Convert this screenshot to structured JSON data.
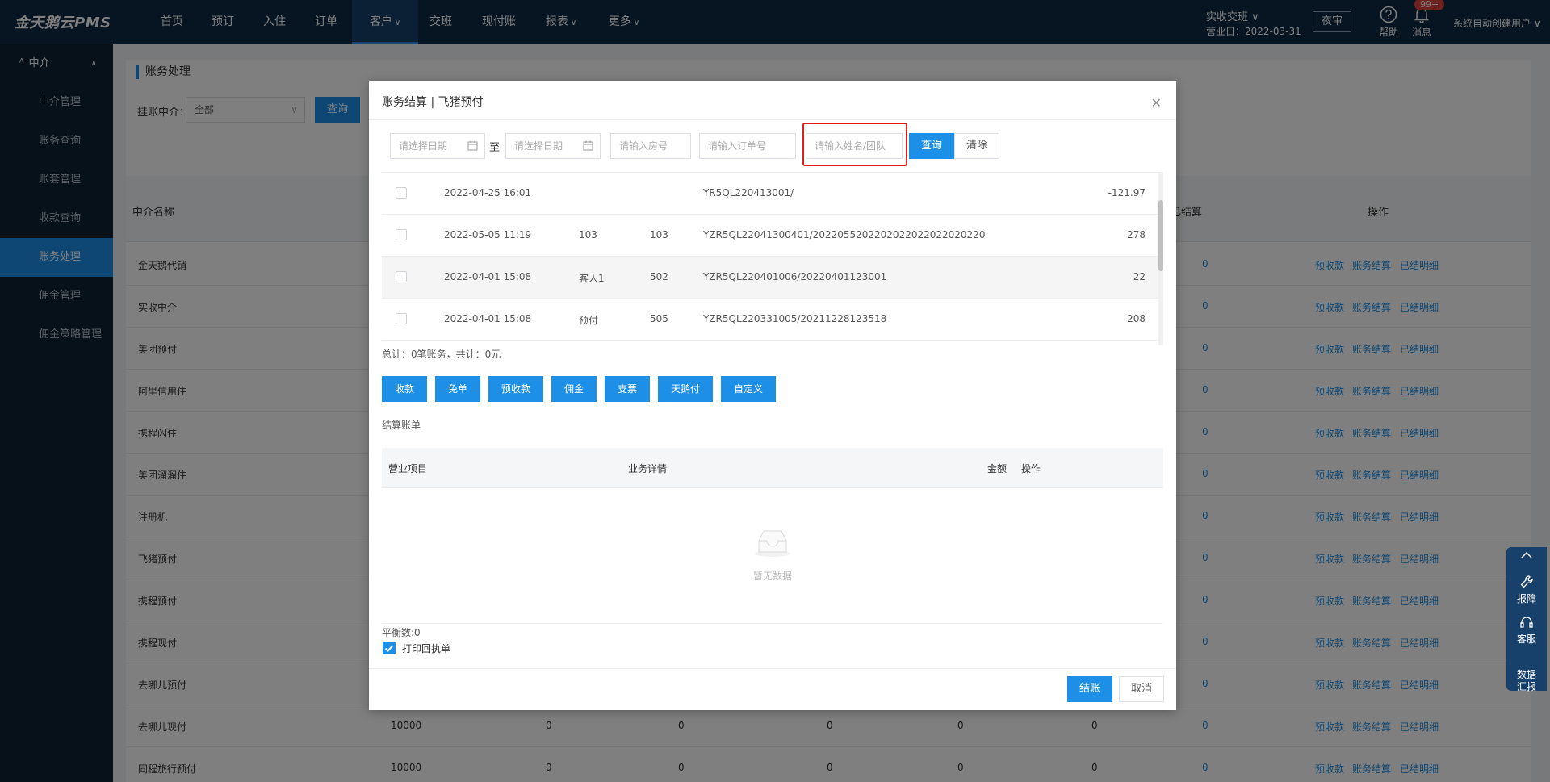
{
  "app": {
    "logo": "金天鹅云PMS"
  },
  "nav": [
    {
      "label": "首页"
    },
    {
      "label": "预订"
    },
    {
      "label": "入住"
    },
    {
      "label": "订单"
    },
    {
      "label": "客户",
      "dropdown": true,
      "active": true
    },
    {
      "label": "交班"
    },
    {
      "label": "现付账"
    },
    {
      "label": "报表",
      "dropdown": true
    },
    {
      "label": "更多",
      "dropdown": true
    }
  ],
  "topbar": {
    "shift_label": "实收交班 ∨",
    "business_day": "营业日：2022-03-31",
    "night_button": "夜审",
    "help_label": "帮助",
    "message_label": "消息",
    "message_badge": "99+",
    "user": "系统自动创建用户 ∨"
  },
  "sidebar": {
    "section": "中介",
    "items": [
      "中介管理",
      "账务查询",
      "账套管理",
      "收款查询",
      "账务处理",
      "佣金管理",
      "佣金策略管理"
    ],
    "active_index": 4
  },
  "page": {
    "title": "账务处理",
    "filter_label": "挂账中介：",
    "filter_value": "全部",
    "query_button": "查询"
  },
  "table": {
    "headers": {
      "name": "中介名称",
      "settled": "已结算",
      "actions": "操作"
    },
    "row_actions": [
      "预收款",
      "账务结算",
      "已结明细"
    ],
    "rows": [
      {
        "name": "金天鹅代销",
        "settled": "0"
      },
      {
        "name": "实收中介",
        "settled": "0"
      },
      {
        "name": "美团预付",
        "settled": "0"
      },
      {
        "name": "阿里信用住",
        "settled": "0"
      },
      {
        "name": "携程闪住",
        "settled": "0"
      },
      {
        "name": "美团溜溜住",
        "settled": "0"
      },
      {
        "name": "注册机",
        "settled": "0"
      },
      {
        "name": "飞猪预付",
        "settled": "0"
      },
      {
        "name": "携程预付",
        "settled": "0"
      },
      {
        "name": "携程现付",
        "settled": "0"
      },
      {
        "name": "去哪儿预付",
        "settled": "0"
      },
      {
        "name": "去哪儿现付",
        "credit": "10000",
        "c1": "0",
        "c2": "0",
        "c3": "0",
        "c4": "0",
        "c5": "0",
        "settled": "0"
      },
      {
        "name": "同程旅行预付",
        "credit": "10000",
        "c1": "0",
        "c2": "0",
        "c3": "0",
        "c4": "0",
        "c5": "0",
        "settled": "0"
      }
    ]
  },
  "modal": {
    "title": "账务结算 | 飞猪预付",
    "date_from_placeholder": "请选择日期",
    "to_label": "至",
    "date_to_placeholder": "请选择日期",
    "room_placeholder": "请输入房号",
    "order_placeholder": "请输入订单号",
    "name_placeholder": "请输入姓名/团队",
    "query_button": "查询",
    "clear_button": "清除",
    "records": [
      {
        "time": "2022-04-25 16:01",
        "guest": "",
        "room": "",
        "order": "YR5QL220413001/",
        "amount": "-121.97"
      },
      {
        "time": "2022-05-05 11:19",
        "guest": "103",
        "room": "103",
        "order": "YZR5QL22041300401/2022055202202022022022020220",
        "amount": "278"
      },
      {
        "time": "2022-04-01 15:08",
        "guest": "客人1",
        "room": "502",
        "order": "YZR5QL220401006/20220401123001",
        "amount": "22"
      },
      {
        "time": "2022-04-01 15:08",
        "guest": "预付",
        "room": "505",
        "order": "YZR5QL220331005/20211228123518",
        "amount": "208"
      }
    ],
    "summary": "总计：0笔账务，共计：0元",
    "actions": [
      "收款",
      "免单",
      "预收款",
      "佣金",
      "支票",
      "天鹅付",
      "自定义"
    ],
    "settle_title": "结算账单",
    "settle_headers": {
      "item": "营业项目",
      "detail": "业务详情",
      "amount": "金额",
      "op": "操作"
    },
    "empty_text": "暂无数据",
    "balance": "平衡数:0",
    "print_label": "打印回执单",
    "print_checked": true,
    "confirm_button": "结账",
    "cancel_button": "取消"
  },
  "float_panel": {
    "items": [
      "报障",
      "客服",
      "数据\n汇报"
    ]
  }
}
